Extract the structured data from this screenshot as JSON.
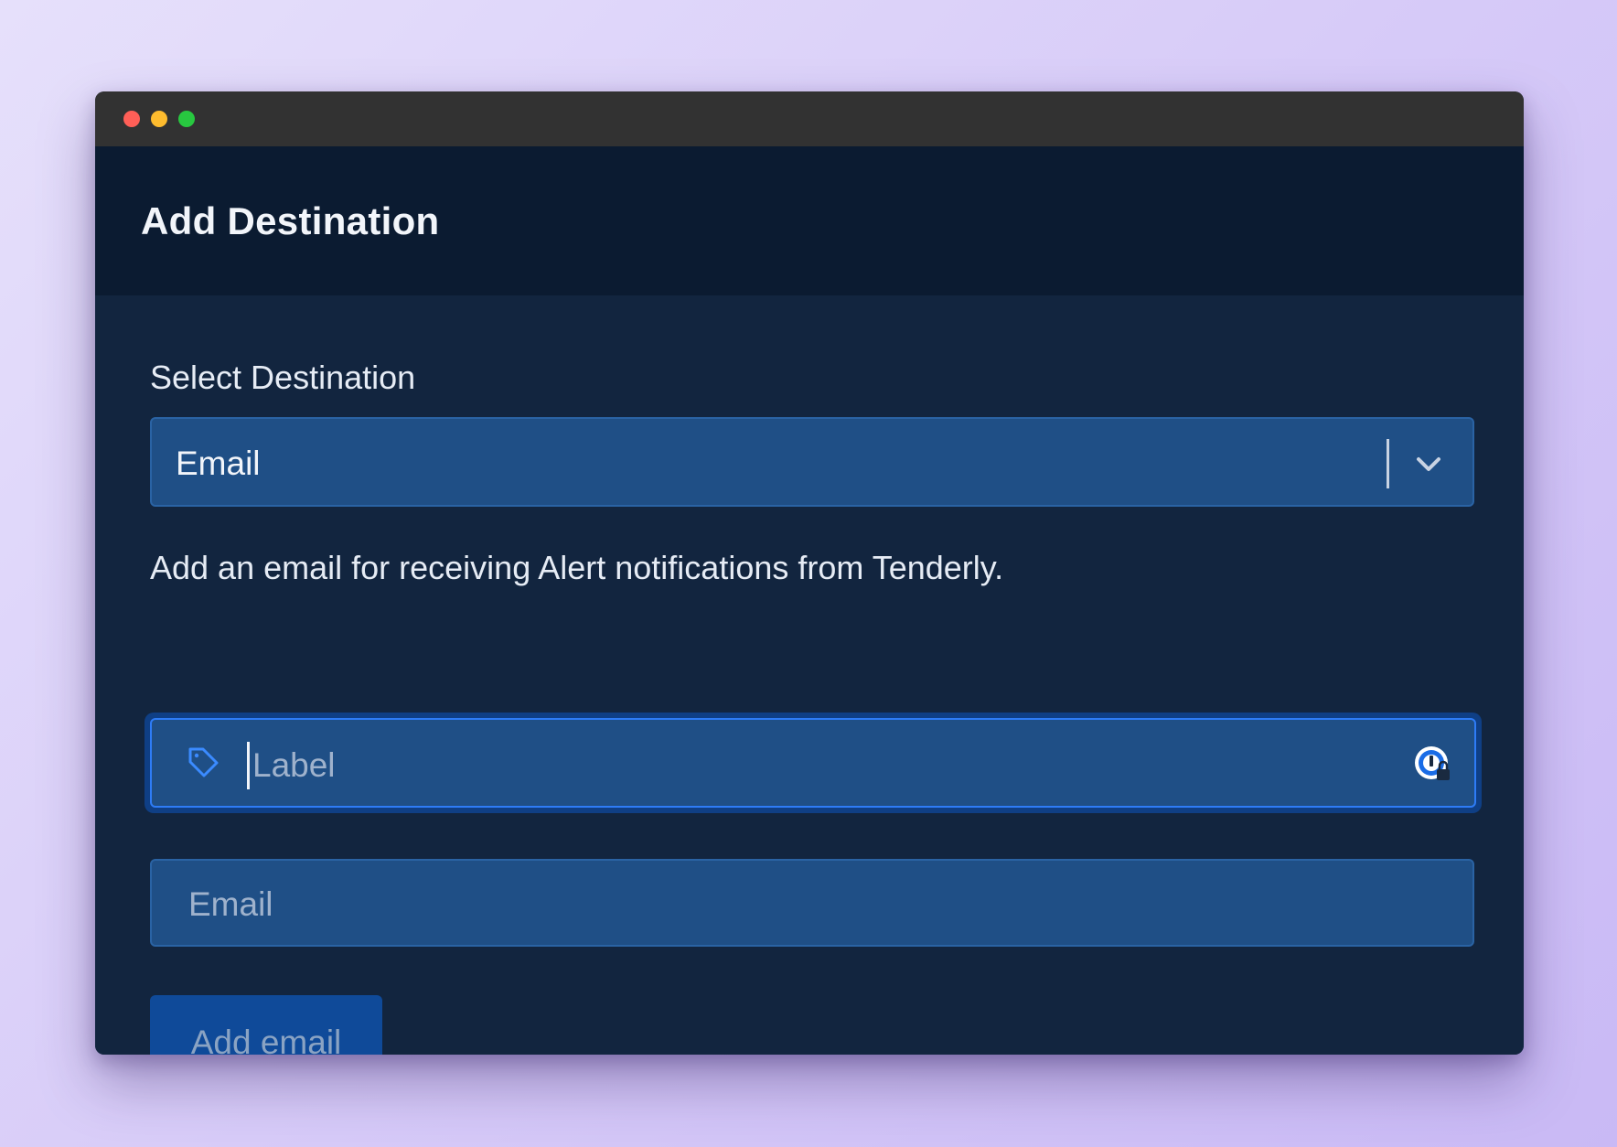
{
  "dialog": {
    "title": "Add Destination"
  },
  "destination": {
    "label": "Select Destination",
    "selected": "Email"
  },
  "description": "Add an email for receiving Alert notifications from Tenderly.",
  "label_field": {
    "placeholder": "Label",
    "value": ""
  },
  "email_field": {
    "placeholder": "Email",
    "value": ""
  },
  "actions": {
    "add_email": "Add email"
  },
  "colors": {
    "accent": "#2e7cf6",
    "input_bg": "#1f4f86",
    "panel_bg": "#12253f",
    "header_bg": "#0b1b31"
  },
  "icons": {
    "label_field_icon": "tag-icon",
    "password_manager_icon": "password-manager-icon",
    "select_arrow_icon": "chevron-down-icon"
  }
}
